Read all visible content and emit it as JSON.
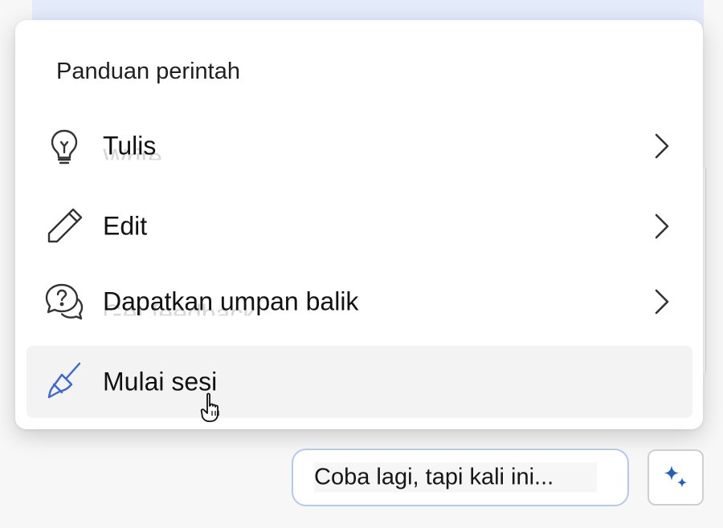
{
  "menu": {
    "title": "Panduan perintah",
    "items": [
      {
        "label": "Tulis",
        "ghost_label": "Write",
        "icon": "lightbulb-icon",
        "has_submenu": true
      },
      {
        "label": "Edit",
        "icon": "pencil-icon",
        "has_submenu": true
      },
      {
        "label": "Dapatkan umpan balik",
        "ghost_label": "Get feedback",
        "icon": "question-chat-icon",
        "has_submenu": true
      },
      {
        "label": "Mulai sesi",
        "icon": "broom-icon",
        "has_submenu": false,
        "hovered": true
      }
    ]
  },
  "suggestion": {
    "label": "Coba lagi, tapi kali ini..."
  },
  "actions": {
    "sparkle_icon": "sparkle-icon"
  },
  "colors": {
    "accent_blue": "#1f5fbf",
    "broom_blue": "#3a67d6",
    "chip_border": "#b4c8f2",
    "hover_bg": "#f3f3f3"
  }
}
